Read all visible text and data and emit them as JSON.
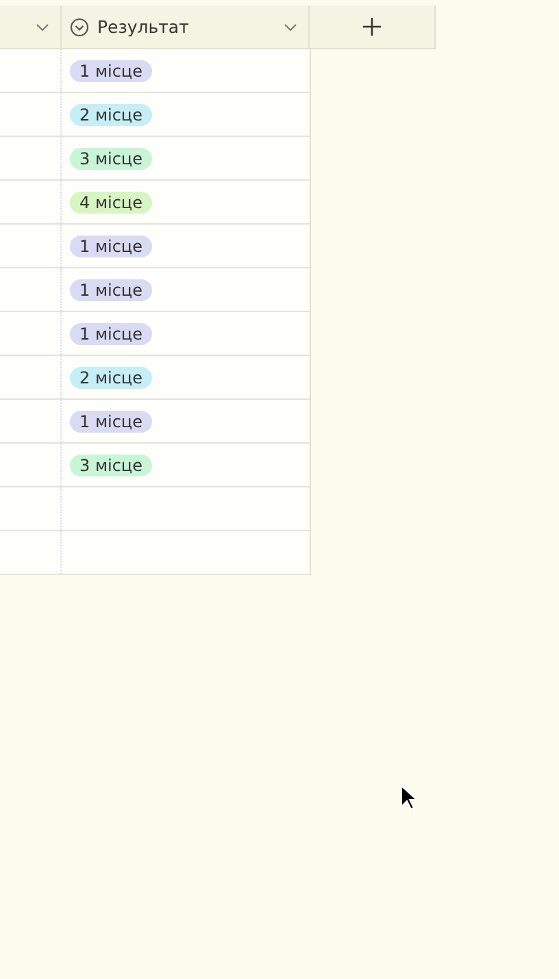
{
  "table": {
    "columns": [
      {
        "kind": "cut"
      },
      {
        "kind": "select",
        "label": "Результат"
      }
    ],
    "rows": [
      {
        "result": {
          "text": "1 місце",
          "color": "#d8dbf2"
        }
      },
      {
        "result": {
          "text": "2 місце",
          "color": "#c6eef6"
        }
      },
      {
        "result": {
          "text": "3 місце",
          "color": "#c8f5d8"
        }
      },
      {
        "result": {
          "text": "4 місце",
          "color": "#d6f5c0"
        }
      },
      {
        "result": {
          "text": "1 місце",
          "color": "#d8dbf2"
        }
      },
      {
        "result": {
          "text": "1 місце",
          "color": "#d8dbf2"
        }
      },
      {
        "result": {
          "text": "1 місце",
          "color": "#d8dbf2"
        }
      },
      {
        "result": {
          "text": "2 місце",
          "color": "#c6eef6"
        }
      },
      {
        "result": {
          "text": "1 місце",
          "color": "#d8dbf2"
        }
      },
      {
        "result": {
          "text": "3 місце",
          "color": "#c8f5d8"
        }
      },
      {
        "result": null
      },
      {
        "result": null
      }
    ]
  }
}
